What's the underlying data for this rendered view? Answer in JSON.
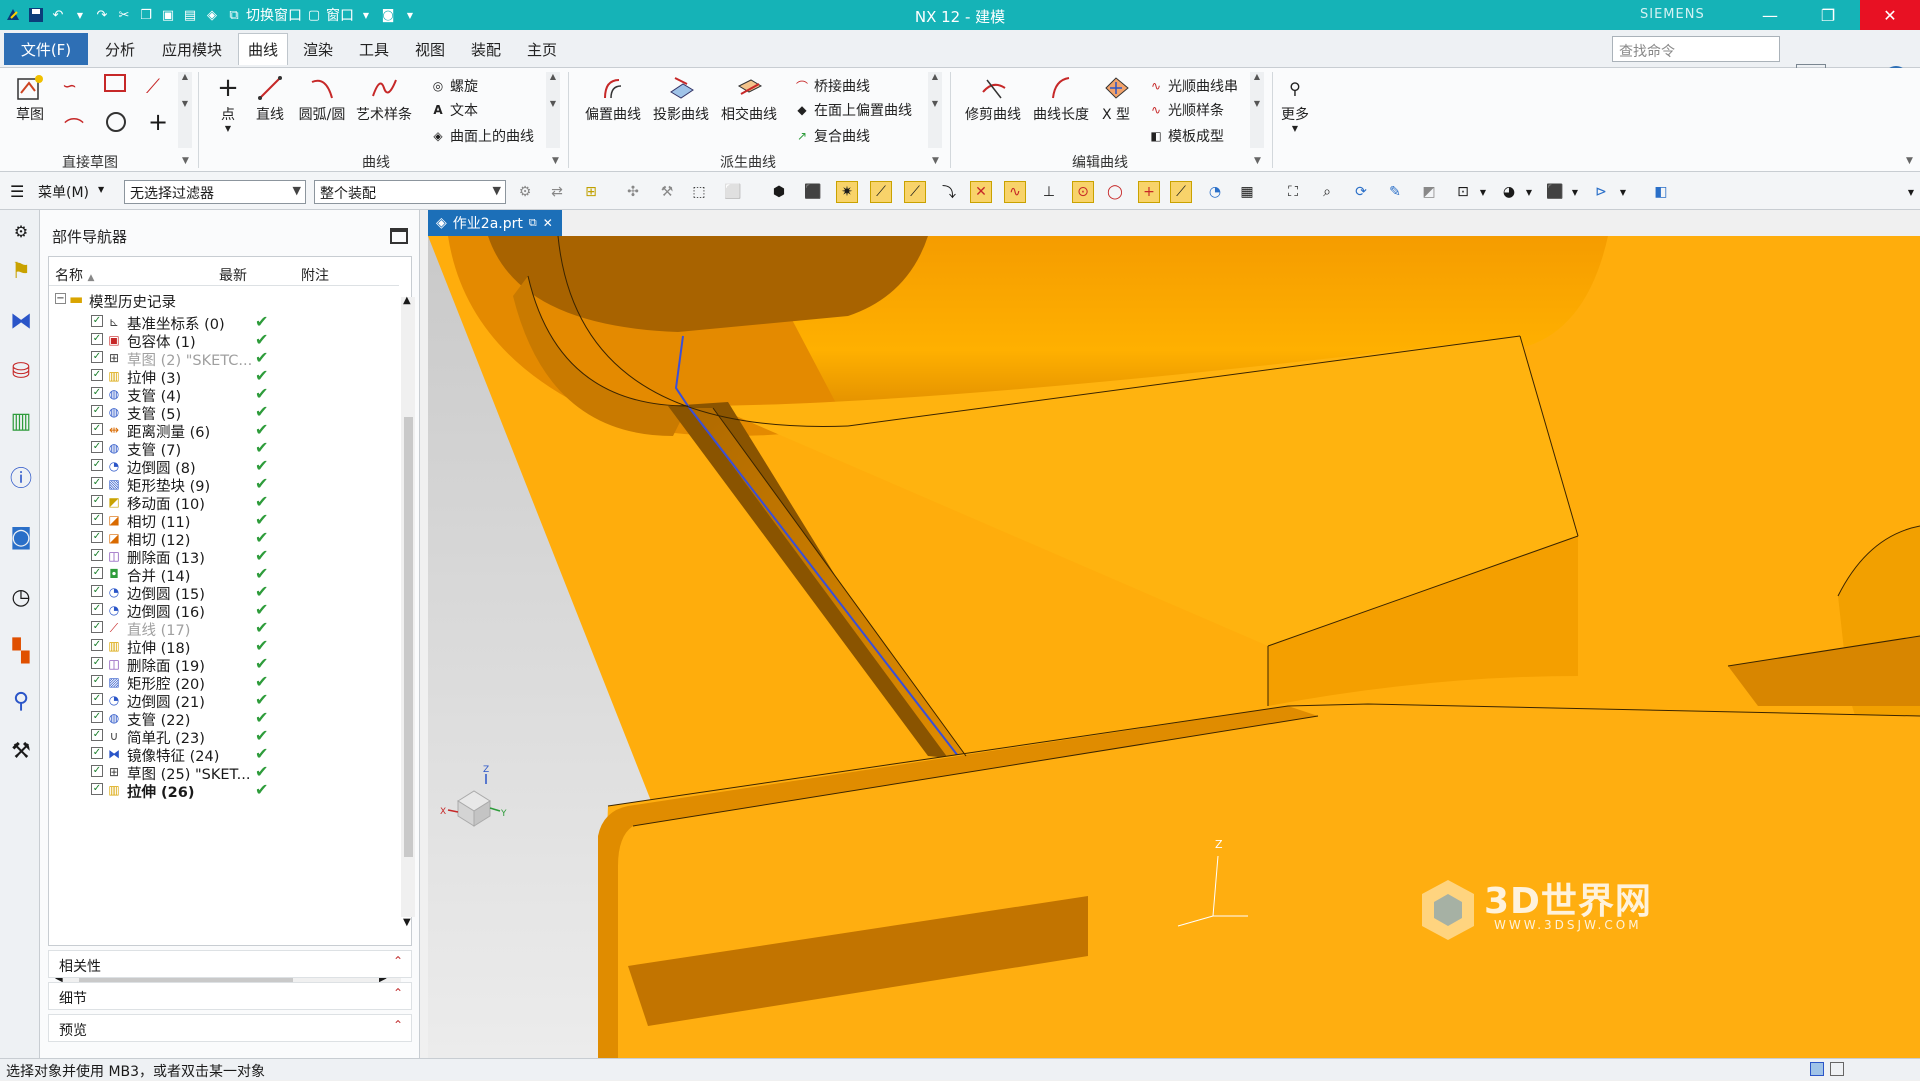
{
  "window": {
    "title": "NX 12 - 建模",
    "brand": "SIEMENS",
    "quick_access_items": [
      "切换窗口",
      "窗口"
    ]
  },
  "menubar": {
    "file": "文件(F)",
    "tabs": [
      "分析",
      "应用模块",
      "曲线",
      "渲染",
      "工具",
      "视图",
      "装配",
      "主页"
    ],
    "active_tab": "曲线",
    "search_placeholder": "查找命令"
  },
  "ribbon": {
    "sketch": {
      "label": "草图",
      "group": "直接草图"
    },
    "curve": {
      "point": "点",
      "line": "直线",
      "arc": "圆弧/圆",
      "spline": "艺术样条",
      "helix": "螺旋",
      "text": "文本",
      "curve_on_surface": "曲面上的曲线",
      "group": "曲线"
    },
    "derived": {
      "offset": "偏置曲线",
      "project": "投影曲线",
      "intersect": "相交曲线",
      "bridge": "桥接曲线",
      "offset_in_face": "在面上偏置曲线",
      "composite": "复合曲线",
      "group": "派生曲线"
    },
    "edit": {
      "trim": "修剪曲线",
      "length": "曲线长度",
      "xform": "X 型",
      "smooth_string": "光顺曲线串",
      "smooth_spline": "光顺样条",
      "template": "模板成型",
      "group": "编辑曲线"
    },
    "more": "更多"
  },
  "toolbar": {
    "menu": "菜单(M)",
    "filter": "无选择过滤器",
    "scope": "整个装配"
  },
  "navigator": {
    "title": "部件导航器",
    "columns": [
      "名称",
      "最新",
      "附注"
    ],
    "root": "模型历史记录",
    "items": [
      {
        "label": "基准坐标系 (0)",
        "icon": "datum-csys-icon",
        "dim": false,
        "bold": false
      },
      {
        "label": "包容体 (1)",
        "icon": "bounding-body-icon",
        "dim": false,
        "bold": false
      },
      {
        "label": "草图 (2) \"SKETC...",
        "icon": "sketch-icon",
        "dim": true,
        "bold": false
      },
      {
        "label": "拉伸 (3)",
        "icon": "extrude-icon",
        "dim": false,
        "bold": false
      },
      {
        "label": "支管 (4)",
        "icon": "tube-icon",
        "dim": false,
        "bold": false
      },
      {
        "label": "支管 (5)",
        "icon": "tube-icon",
        "dim": false,
        "bold": false
      },
      {
        "label": "距离测量 (6)",
        "icon": "measure-icon",
        "dim": false,
        "bold": false
      },
      {
        "label": "支管 (7)",
        "icon": "tube-icon",
        "dim": false,
        "bold": false
      },
      {
        "label": "边倒圆 (8)",
        "icon": "edge-blend-icon",
        "dim": false,
        "bold": false
      },
      {
        "label": "矩形垫块 (9)",
        "icon": "pad-icon",
        "dim": false,
        "bold": false
      },
      {
        "label": "移动面 (10)",
        "icon": "move-face-icon",
        "dim": false,
        "bold": false
      },
      {
        "label": "相切 (11)",
        "icon": "tangent-icon",
        "dim": false,
        "bold": false
      },
      {
        "label": "相切 (12)",
        "icon": "tangent-icon",
        "dim": false,
        "bold": false
      },
      {
        "label": "删除面 (13)",
        "icon": "delete-face-icon",
        "dim": false,
        "bold": false
      },
      {
        "label": "合并 (14)",
        "icon": "unite-icon",
        "dim": false,
        "bold": false
      },
      {
        "label": "边倒圆 (15)",
        "icon": "edge-blend-icon",
        "dim": false,
        "bold": false
      },
      {
        "label": "边倒圆 (16)",
        "icon": "edge-blend-icon",
        "dim": false,
        "bold": false
      },
      {
        "label": "直线 (17)",
        "icon": "line-icon",
        "dim": true,
        "bold": false
      },
      {
        "label": "拉伸 (18)",
        "icon": "extrude-icon",
        "dim": false,
        "bold": false
      },
      {
        "label": "删除面 (19)",
        "icon": "delete-face-icon",
        "dim": false,
        "bold": false
      },
      {
        "label": "矩形腔 (20)",
        "icon": "pocket-icon",
        "dim": false,
        "bold": false
      },
      {
        "label": "边倒圆 (21)",
        "icon": "edge-blend-icon",
        "dim": false,
        "bold": false
      },
      {
        "label": "支管 (22)",
        "icon": "tube-icon",
        "dim": false,
        "bold": false
      },
      {
        "label": "简单孔 (23)",
        "icon": "hole-icon",
        "dim": false,
        "bold": false
      },
      {
        "label": "镜像特征 (24)",
        "icon": "mirror-icon",
        "dim": false,
        "bold": false
      },
      {
        "label": "草图 (25) \"SKET...",
        "icon": "sketch-icon",
        "dim": false,
        "bold": false
      },
      {
        "label": "拉伸 (26)",
        "icon": "extrude-icon",
        "dim": false,
        "bold": true
      }
    ],
    "panels": [
      "相关性",
      "细节",
      "预览"
    ]
  },
  "viewport": {
    "tab_label": "作业2a.prt",
    "model_color": "#f7a500",
    "edge_color": "#3a2400",
    "highlight_color": "#3a4fd8",
    "axis_labels": [
      "Z",
      "X",
      "Y"
    ]
  },
  "status": {
    "text": "选择对象并使用 MB3，或者双击某一对象"
  },
  "watermark": {
    "name": "3D世界网",
    "url": "WWW.3DSJW.COM"
  }
}
